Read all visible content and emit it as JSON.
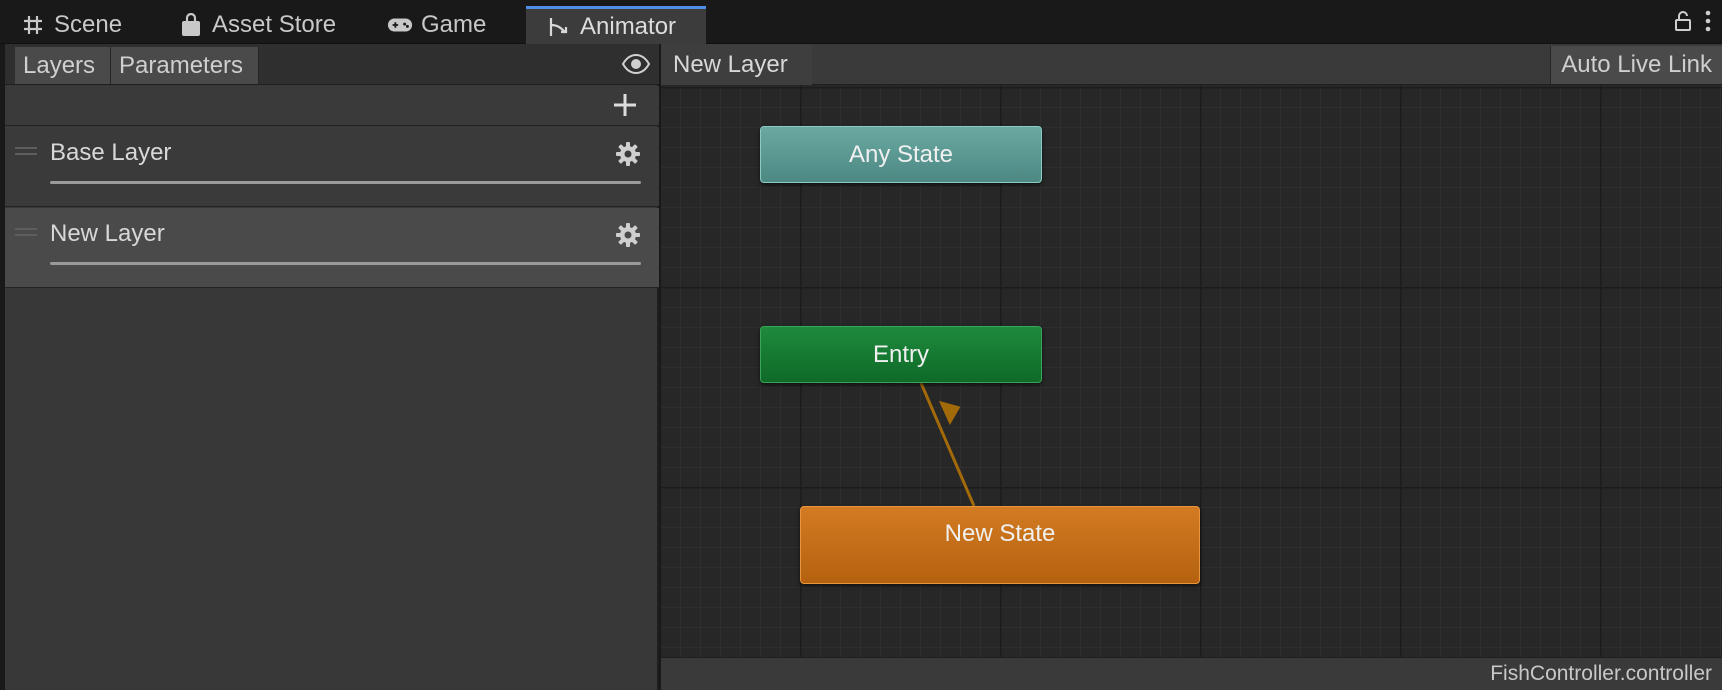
{
  "tabs": [
    {
      "label": "Scene",
      "icon": "grid-icon",
      "active": false
    },
    {
      "label": "Asset Store",
      "icon": "shopping-bag-icon",
      "active": false
    },
    {
      "label": "Game",
      "icon": "gamepad-icon",
      "active": false
    },
    {
      "label": "Animator",
      "icon": "animator-icon",
      "active": true
    }
  ],
  "window_controls": {
    "lock_icon": "lock-icon",
    "menu_icon": "kebab-menu-icon"
  },
  "left_panel": {
    "tabs": [
      "Layers",
      "Parameters"
    ],
    "eye_icon": "eye-icon",
    "add_icon": "plus-icon",
    "layers": [
      {
        "name": "Base Layer",
        "weight": 1.0,
        "selected": false
      },
      {
        "name": "New Layer",
        "weight": 1.0,
        "selected": true
      }
    ]
  },
  "graph": {
    "breadcrumb": "New Layer",
    "auto_live_link": "Auto Live Link",
    "nodes": {
      "any_state": "Any State",
      "entry": "Entry",
      "new_state": "New State"
    },
    "status": "FishController.controller"
  },
  "colors": {
    "active_tab_accent": "#4d8ee6",
    "any_state": "#5e9c96",
    "entry": "#177c33",
    "default_state": "#c66f18",
    "transition": "#a26a08"
  }
}
